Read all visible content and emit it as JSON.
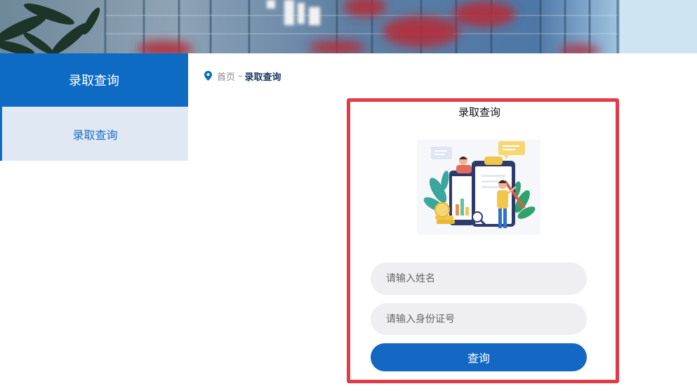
{
  "colors": {
    "primary": "#0d6bc4",
    "sidebar_item_bg": "#e0e9f3",
    "sidebar_item_text": "#1c6ec2",
    "highlight_border": "#e23a46",
    "input_bg": "#eeeef3",
    "breadcrumb_current": "#1b3a66",
    "button_bg": "#1268c3"
  },
  "sidebar": {
    "header_title": "录取查询",
    "items": [
      {
        "label": "录取查询",
        "active": true
      }
    ]
  },
  "breadcrumb": {
    "icon": "location-pin-icon",
    "home": "首页",
    "separator": "–",
    "current": "录取查询"
  },
  "query_form": {
    "title": "录取查询",
    "illustration_icon": "data-report-illustration",
    "name_field": {
      "placeholder": "请输入姓名"
    },
    "id_field": {
      "placeholder": "请输入身份证号"
    },
    "submit_label": "查询"
  }
}
